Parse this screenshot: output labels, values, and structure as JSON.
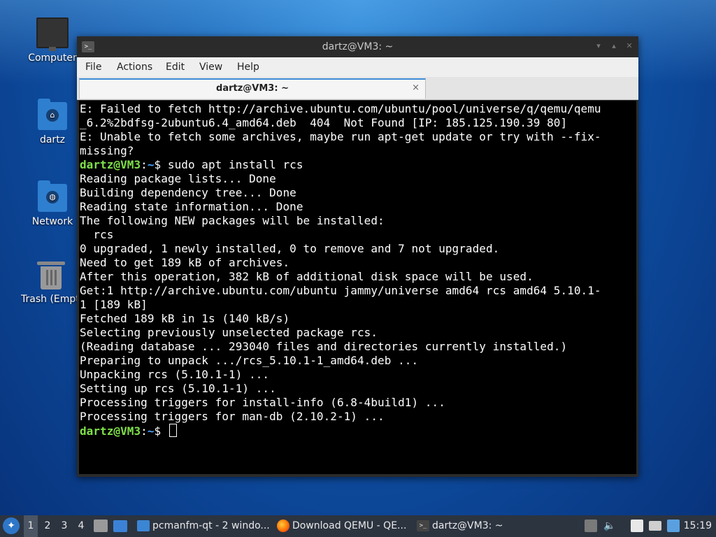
{
  "desktop": {
    "icons": [
      {
        "label": "Computer"
      },
      {
        "label": "dartz"
      },
      {
        "label": "Network"
      },
      {
        "label": "Trash (Empty)"
      }
    ]
  },
  "window": {
    "title": "dartz@VM3: ~",
    "menu": [
      "File",
      "Actions",
      "Edit",
      "View",
      "Help"
    ],
    "tab": {
      "label": "dartz@VM3: ~",
      "close_glyph": "×"
    }
  },
  "terminal": {
    "prompt_user": "dartz@VM3",
    "prompt_path": "~",
    "lines": [
      "E: Failed to fetch http://archive.ubuntu.com/ubuntu/pool/universe/q/qemu/qemu",
      "_6.2%2bdfsg-2ubuntu6.4_amd64.deb  404  Not Found [IP: 185.125.190.39 80]",
      "E: Unable to fetch some archives, maybe run apt-get update or try with --fix-",
      "missing?",
      "Reading package lists... Done",
      "Building dependency tree... Done",
      "Reading state information... Done",
      "The following NEW packages will be installed:",
      "  rcs",
      "0 upgraded, 1 newly installed, 0 to remove and 7 not upgraded.",
      "Need to get 189 kB of archives.",
      "After this operation, 382 kB of additional disk space will be used.",
      "Get:1 http://archive.ubuntu.com/ubuntu jammy/universe amd64 rcs amd64 5.10.1-",
      "1 [189 kB]",
      "Fetched 189 kB in 1s (140 kB/s)",
      "Selecting previously unselected package rcs.",
      "(Reading database ... 293040 files and directories currently installed.)",
      "Preparing to unpack .../rcs_5.10.1-1_amd64.deb ...",
      "Unpacking rcs (5.10.1-1) ...",
      "Setting up rcs (5.10.1-1) ...",
      "Processing triggers for install-info (6.8-4build1) ...",
      "Processing triggers for man-db (2.10.2-1) ..."
    ],
    "command": "$ sudo apt install rcs",
    "prompt_end": "$ "
  },
  "taskbar": {
    "workspaces": [
      "1",
      "2",
      "3",
      "4"
    ],
    "tasks": [
      {
        "label": "pcmanfm-qt - 2 windo...",
        "icon": "folder-icon"
      },
      {
        "label": "Download QEMU - QE...",
        "icon": "firefox-icon"
      },
      {
        "label": "dartz@VM3: ~",
        "icon": "terminal-icon"
      }
    ],
    "clock": "15:19"
  }
}
